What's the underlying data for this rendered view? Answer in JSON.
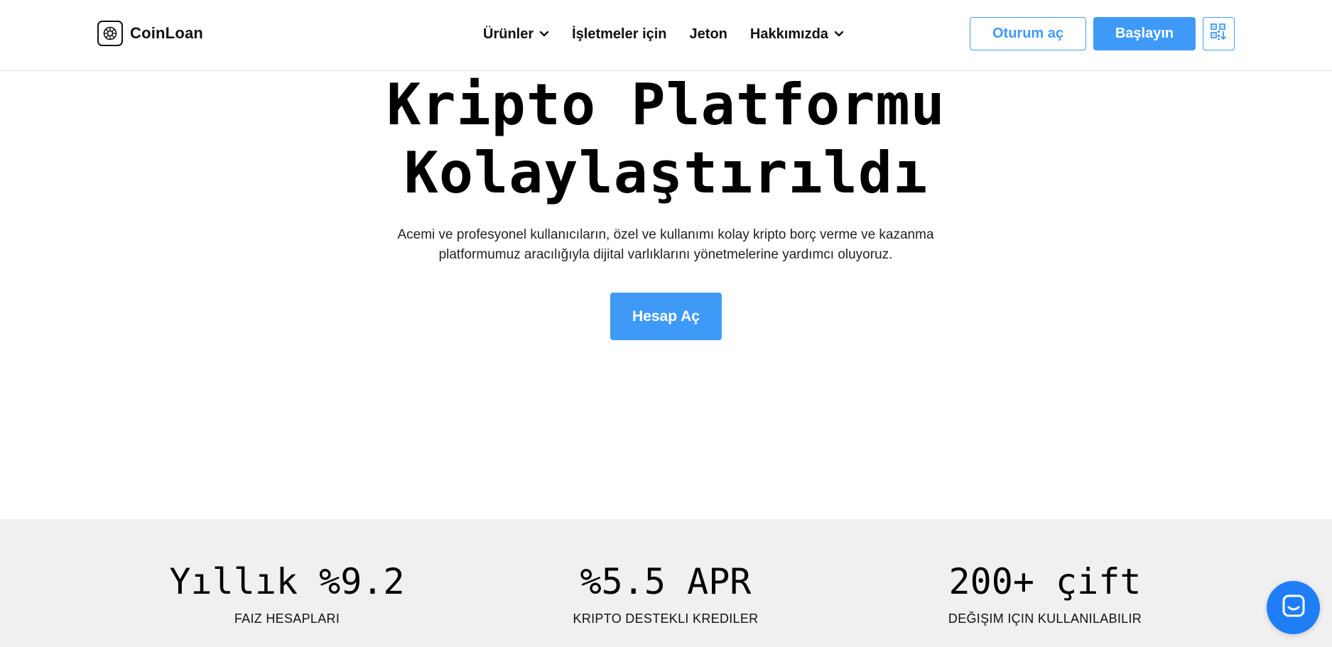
{
  "header": {
    "logo_text": "CoinLoan",
    "nav": [
      {
        "label": "Ürünler",
        "has_dropdown": true
      },
      {
        "label": "İşletmeler için",
        "has_dropdown": false
      },
      {
        "label": "Jeton",
        "has_dropdown": false
      },
      {
        "label": "Hakkımızda",
        "has_dropdown": true
      }
    ],
    "login_label": "Oturum aç",
    "start_label": "Başlayın",
    "qr_icon": "qr-download-icon"
  },
  "hero": {
    "title_line1": "Kripto Platformu",
    "title_line2": "Kolaylaştırıldı",
    "subtitle_line1": "Acemi ve profesyonel kullanıcıların, özel ve kullanımı kolay kripto borç verme ve kazanma",
    "subtitle_line2": "platformumuz aracılığıyla dijital varlıklarını yönetmelerine yardımcı oluyoruz.",
    "cta_label": "Hesap Aç"
  },
  "stats": [
    {
      "value": "Yıllık %9.2",
      "label": "FAIZ HESAPLARI"
    },
    {
      "value": "%5.5 APR",
      "label": "KRIPTO DESTEKLI KREDILER"
    },
    {
      "value": "200+ çift",
      "label": "DEĞIŞIM IÇIN KULLANILABILIR"
    }
  ],
  "colors": {
    "accent": "#3f9af7",
    "chat": "#1f7ef5",
    "stats_bg": "#f0f0f0"
  }
}
